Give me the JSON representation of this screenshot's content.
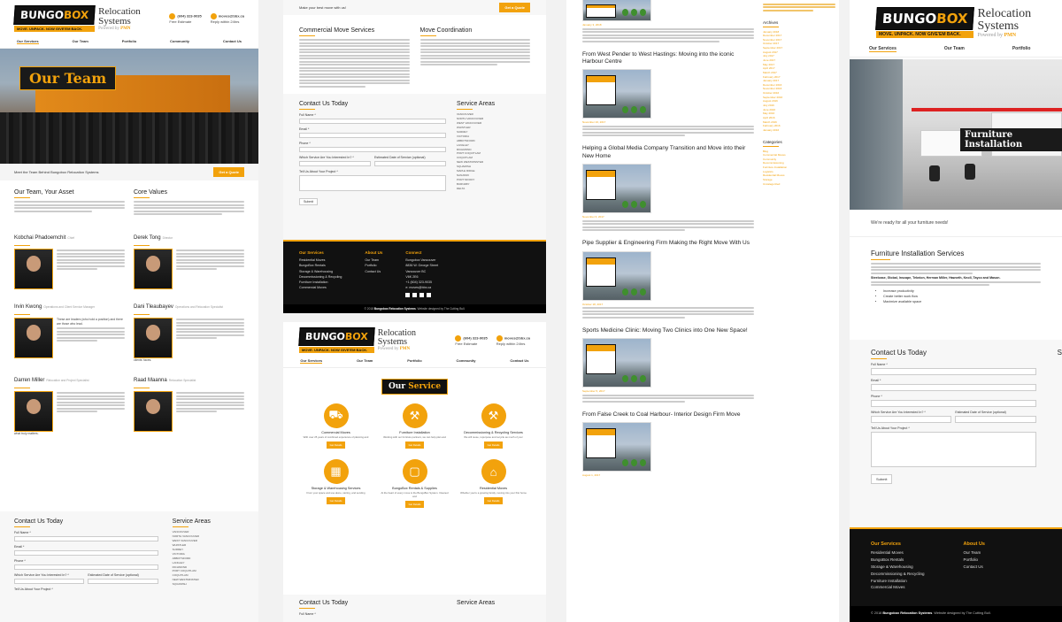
{
  "brand": {
    "name_a": "BUNGO",
    "name_b": "BOX",
    "tagline": "MOVE. UNPACK. NOW GIVE'EM BACK.",
    "relocation": "Relocation",
    "systems": "Systems",
    "powered_by": "Powered by",
    "powered_brand": "PMN"
  },
  "contact": {
    "phone": "(604) 323-9035",
    "phone_sub": "Free Estimate",
    "email": "moves@bbx.ca",
    "email_sub": "Reply within 24hrs"
  },
  "nav": [
    "Our Services",
    "Our Team",
    "Portfolio",
    "Community",
    "Contact Us"
  ],
  "team_page": {
    "hero_title": "Our Team",
    "banner_text": "Meet the Team Behind Bungobox Relocation Systems",
    "quote_btn": "Get a Quote",
    "asset_title": "Our Team, Your Asset",
    "values_title": "Core Values",
    "members": [
      {
        "name": "Kobchai Phadoemchit",
        "role": "Chief"
      },
      {
        "name": "Derek Tong",
        "role": "Director"
      },
      {
        "name": "Irvin Kwong",
        "role": "Operations and Client Service Manager"
      },
      {
        "name": "Dani Tleaubayev",
        "role": "Operations and Relocation Specialist"
      },
      {
        "name": "Darren Miller",
        "role": "Relocation and Project Specialist"
      },
      {
        "name": "Raad Maanna",
        "role": "Relocation Specialist"
      }
    ],
    "irvin_quote": "These are leaders (who hold a position) and there are those who lead.",
    "dani_note": "clients' faces.",
    "darren_note": "what truly matters."
  },
  "contact_form": {
    "title": "Contact Us Today",
    "full_name": "Full Name *",
    "email": "Email *",
    "phone": "Phone *",
    "service": "Which Service Are You Interested In? *",
    "date": "Estimated Date of Service (optional)",
    "project": "Tell Us About Your Project *",
    "submit": "Submit",
    "areas_title": "Service Areas",
    "areas": [
      "VANCOUVER",
      "NORTH VANCOUVER",
      "WEST VANCOUVER",
      "WHISTLER",
      "SURREY",
      "VICTORIA",
      "ABBOTSFORD",
      "LANGLEY",
      "RICHMOND",
      "PORT COQUITLAM",
      "COQUITLAM",
      "NEW WESTMINSTER",
      "SQUAMISH",
      "MAPLE RIDGE",
      "NANAIMO",
      "PORT MOODY",
      "BURNABY",
      "DELTA"
    ]
  },
  "services_page": {
    "top_banner": "Make your best move with us!",
    "top_btn": "Get a Quote",
    "commercial_title": "Commercial Move Services",
    "coordination_title": "Move Coordination",
    "section_title_a": "Our",
    "section_title_b": "Service",
    "services": [
      {
        "name": "Commercial Moves",
        "desc": "With over 25 years of combined experience of planning and",
        "btn": "Get Details",
        "icon": "truck-icon"
      },
      {
        "name": "Furniture Installation",
        "desc": "Working with our furniture partners, we can help plan and",
        "btn": "Get Details",
        "icon": "wrench-icon"
      },
      {
        "name": "Decommissioning & Recycling Services",
        "desc": "We will reuse, repurpose and recycle as much of your",
        "btn": "Get Details",
        "icon": "hammer-icon"
      },
      {
        "name": "Storage & Warehousing Services",
        "desc": "From your space and use alone, storing, and sending",
        "btn": "Get Details",
        "icon": "storage-icon"
      },
      {
        "name": "BungoBox Rentals & Supplies",
        "desc": "At the heart of every move is the BungoBox System. Cleaned and",
        "btn": "Get Details",
        "icon": "box-icon"
      },
      {
        "name": "Residential Moves",
        "desc": "Whether you're a growing family, moving into your first home",
        "btn": "Get Details",
        "icon": "house-icon"
      }
    ]
  },
  "footer": {
    "services_title": "Our Services",
    "services": [
      "Residential Moves",
      "BungoBox Rentals",
      "Storage & Warehousing",
      "Decommissioning & Recycling",
      "Furniture Installation",
      "Commercial Moves"
    ],
    "about_title": "About Us",
    "about": [
      "Our Team",
      "Portfolio",
      "Contact Us"
    ],
    "connect_title": "Connect",
    "connect": [
      "Bungobox Vancouver",
      "8836 W. George Street",
      "Vancouver BC",
      "V6K 2E6",
      "+1 (604) 323-9035",
      "e: moves@bbx.ca"
    ],
    "copyright_a": "© 2018",
    "copyright_b": "Bungobox Relocation Systems",
    "copyright_c": ". Website designed by The Cutting Bull."
  },
  "blog": {
    "posts": [
      {
        "title": "From West Pender to West Hastings: Moving into the iconic Harbour Centre",
        "date": "November 16, 2017"
      },
      {
        "title": "Helping a Global Media Company Transition and Move into their New Home",
        "date": "November 6, 2017"
      },
      {
        "title": "Pipe Supplier & Engineering Firm Making the Right Move With Us",
        "date": "October 18, 2017"
      },
      {
        "title": "Sports Medicine Clinic: Moving Two Clinics into One New Space!",
        "date": "September 5, 2017"
      },
      {
        "title": "From False Creek to Coal Harbour- Interior Design Firm Move",
        "date": "August 1, 2017"
      }
    ],
    "first_date": "January 3, 2018"
  },
  "sidebar": {
    "archives_title": "Archives",
    "archives": [
      "January 2018",
      "December 2017",
      "November 2017",
      "October 2017",
      "September 2017",
      "August 2017",
      "July 2017",
      "June 2017",
      "May 2017",
      "April 2017",
      "March 2017",
      "February 2017",
      "January 2017",
      "December 2016",
      "November 2016",
      "October 2016",
      "September 2016",
      "August 2016",
      "July 2016",
      "June 2016",
      "May 2016",
      "April 2016",
      "March 2016",
      "February 2016",
      "January 2016"
    ],
    "categories_title": "Categories",
    "categories": [
      "Blog",
      "Commercial Moves",
      "Community",
      "Decommissioning",
      "Furniture Installation",
      "Logistics",
      "Residential Moves",
      "Storage",
      "Uncategorized"
    ]
  },
  "furniture_page": {
    "hero_title": "Furniture Installation",
    "intro": "We're ready for all your furniture needs!",
    "section_title": "Furniture Installation Services",
    "brands": "Steelcase, Global, Inscape, Teknion, Herman Miller, Haworth, Knoll, Tayco and Mason.",
    "bullets": [
      "Increase productivity",
      "Create better work flow",
      "Maximize available space"
    ]
  }
}
